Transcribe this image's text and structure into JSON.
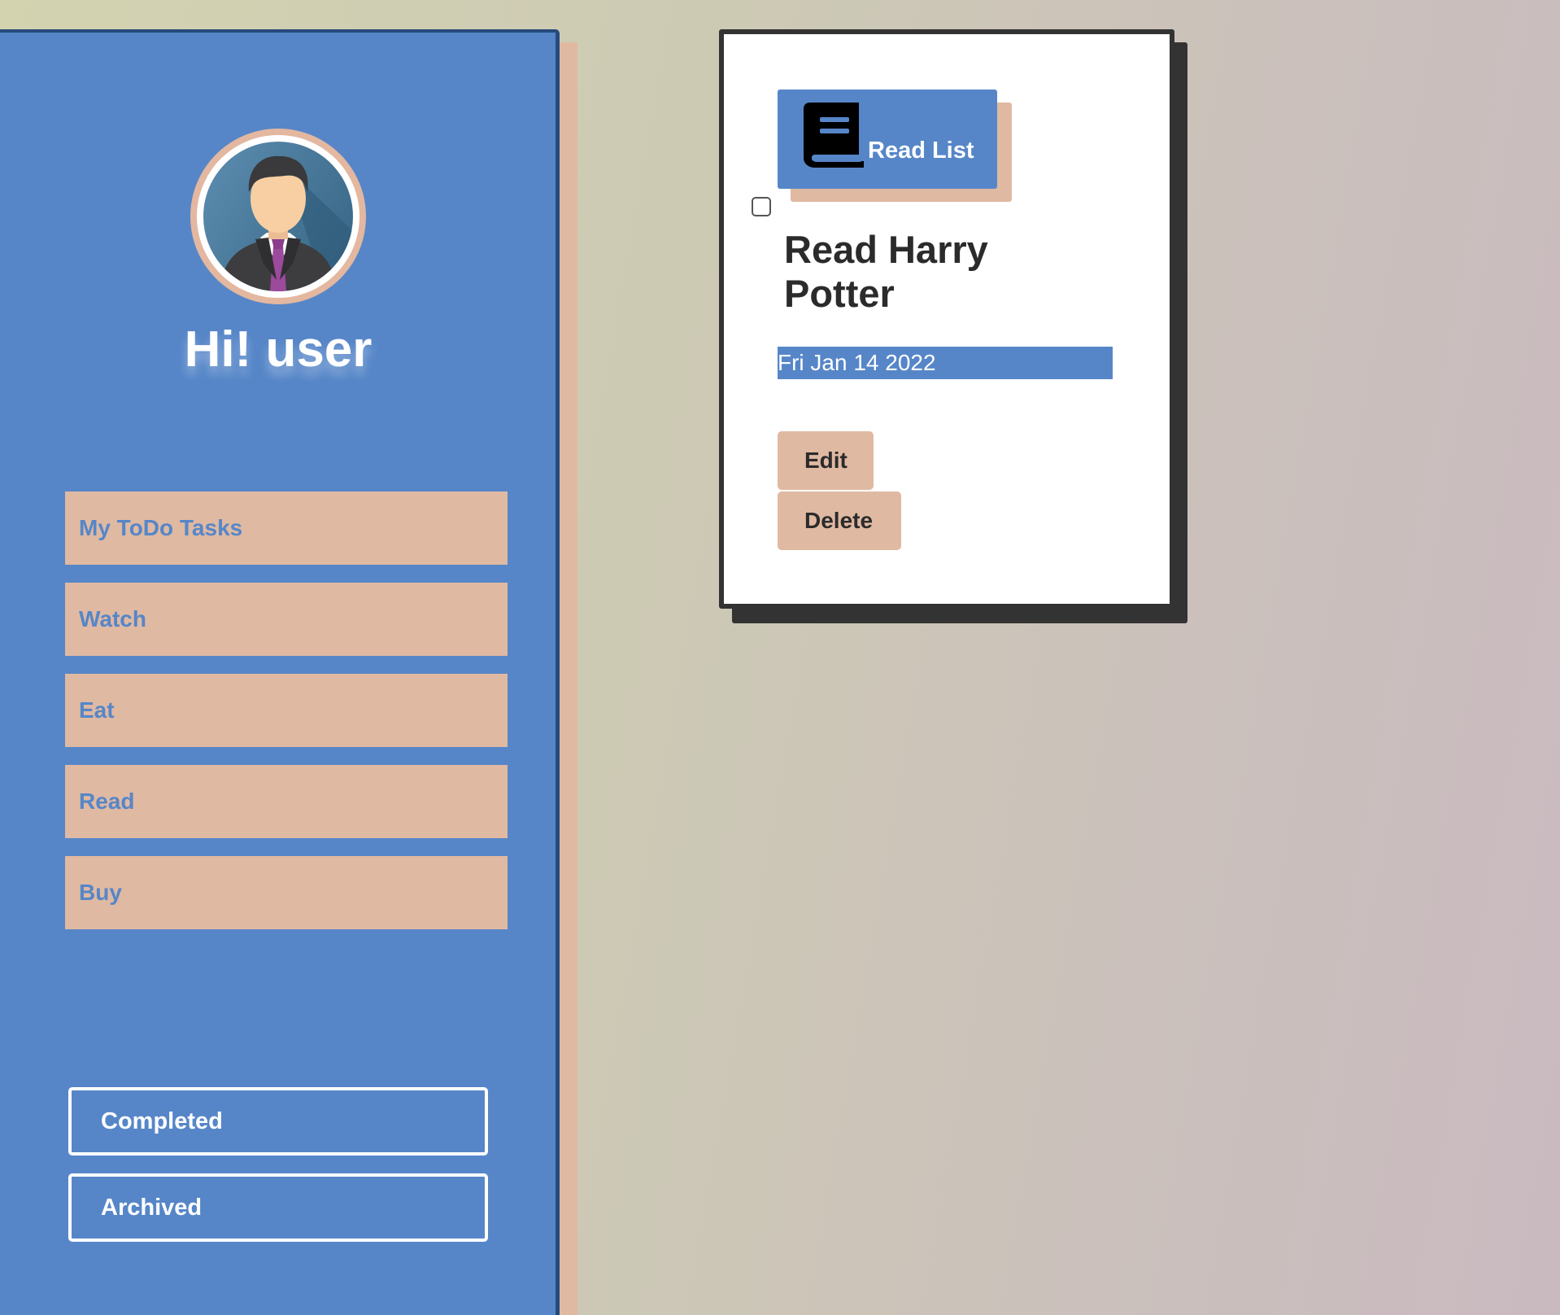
{
  "sidebar": {
    "greeting": "Hi! user",
    "avatar_icon": "user-avatar-icon",
    "categories": [
      {
        "label": "My ToDo Tasks"
      },
      {
        "label": "Watch"
      },
      {
        "label": "Eat"
      },
      {
        "label": "Read"
      },
      {
        "label": "Buy"
      }
    ],
    "filters": [
      {
        "label": "Completed"
      },
      {
        "label": "Archived"
      }
    ]
  },
  "task_card": {
    "tag_label": "Read List",
    "tag_icon": "book-icon",
    "completed": false,
    "title": "Read Harry Potter",
    "date": "Fri Jan 14 2022",
    "edit_label": "Edit",
    "delete_label": "Delete"
  },
  "colors": {
    "primary_blue": "#5686c8",
    "accent_peach": "#e0b9a2",
    "dark": "#333333",
    "text_dark": "#2b2b2b",
    "white": "#ffffff"
  }
}
